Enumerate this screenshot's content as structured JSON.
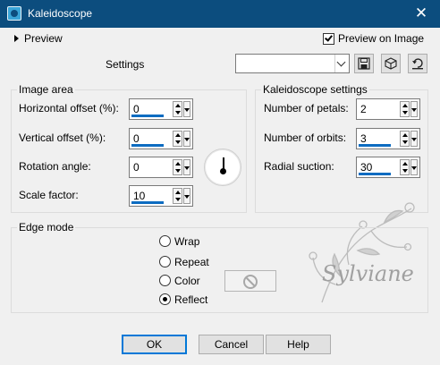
{
  "window": {
    "title": "Kaleidoscope",
    "close_glyph": "✕"
  },
  "preview": {
    "label": "Preview",
    "on_image_label": "Preview on Image",
    "on_image_checked": true
  },
  "settings": {
    "label": "Settings",
    "value": ""
  },
  "toolbar": {
    "icons": [
      "save-icon",
      "cube-icon",
      "reset-icon"
    ]
  },
  "image_area": {
    "title": "Image area",
    "fields": [
      {
        "label": "Horizontal offset (%):",
        "value": "0"
      },
      {
        "label": "Vertical offset (%):",
        "value": "0"
      },
      {
        "label": "Rotation angle:",
        "value": "0"
      },
      {
        "label": "Scale factor:",
        "value": "10"
      }
    ]
  },
  "kaleidoscope": {
    "title": "Kaleidoscope settings",
    "fields": [
      {
        "label": "Number of petals:",
        "value": "2"
      },
      {
        "label": "Number of orbits:",
        "value": "3"
      },
      {
        "label": "Radial suction:",
        "value": "30"
      }
    ]
  },
  "edge_mode": {
    "title": "Edge mode",
    "options": [
      {
        "label": "Wrap",
        "selected": false
      },
      {
        "label": "Repeat",
        "selected": false
      },
      {
        "label": "Color",
        "selected": false
      },
      {
        "label": "Reflect",
        "selected": true
      }
    ]
  },
  "watermark": {
    "text": "Sylviane"
  },
  "buttons": {
    "ok": "OK",
    "cancel": "Cancel",
    "help": "Help"
  },
  "colors": {
    "titlebar": "#0c4d7e",
    "accent": "#0078d7",
    "field_underline": "#0d6cc1"
  }
}
